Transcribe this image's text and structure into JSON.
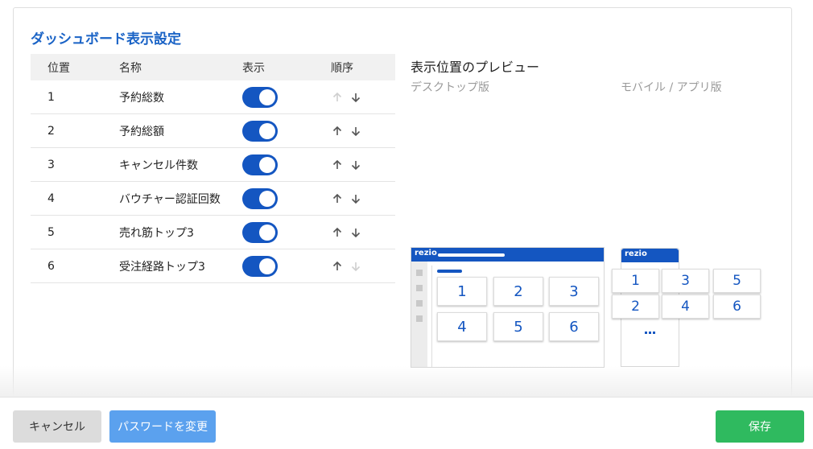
{
  "title": "ダッシュボード表示設定",
  "table": {
    "headers": {
      "position": "位置",
      "name": "名称",
      "display": "表示",
      "order": "順序"
    },
    "rows": [
      {
        "position": "1",
        "name": "予約総数",
        "display": true,
        "up_enabled": false,
        "down_enabled": true
      },
      {
        "position": "2",
        "name": "予約総額",
        "display": true,
        "up_enabled": true,
        "down_enabled": true
      },
      {
        "position": "3",
        "name": "キャンセル件数",
        "display": true,
        "up_enabled": true,
        "down_enabled": true
      },
      {
        "position": "4",
        "name": "バウチャー認証回数",
        "display": true,
        "up_enabled": true,
        "down_enabled": true
      },
      {
        "position": "5",
        "name": "売れ筋トップ3",
        "display": true,
        "up_enabled": true,
        "down_enabled": true
      },
      {
        "position": "6",
        "name": "受注経路トップ3",
        "display": true,
        "up_enabled": true,
        "down_enabled": false
      }
    ]
  },
  "preview": {
    "title": "表示位置のプレビュー",
    "desktop_label": "デスクトップ版",
    "mobile_label": "モバイル / アプリ版",
    "brand": "rezio",
    "desktop_tiles": [
      "1",
      "2",
      "3",
      "4",
      "5",
      "6"
    ],
    "mobile_tiles": [
      "1",
      "3",
      "5",
      "2",
      "4",
      "6"
    ]
  },
  "footer": {
    "cancel_label": "キャンセル",
    "password_label": "パスワードを変更",
    "save_label": "保存"
  },
  "colors": {
    "accent": "#1456c1",
    "title": "#1a63c6",
    "save": "#2fba5f",
    "password": "#5ba1ee",
    "cancel": "#dcdcdc"
  }
}
